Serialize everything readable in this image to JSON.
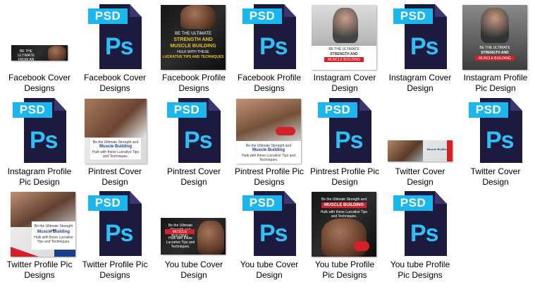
{
  "items": [
    {
      "label": "Facebook Cover Designs"
    },
    {
      "label": "Facebook Cover Designs"
    },
    {
      "label": "Facebook Profile Designs"
    },
    {
      "label": "Facebook Profile Designs"
    },
    {
      "label": "Instagram Cover Design"
    },
    {
      "label": "Instagram Cover Design"
    },
    {
      "label": "Instagram Profile Pic Design"
    },
    {
      "label": "Instagram Profile Pic Design"
    },
    {
      "label": "Pintrest Cover Design"
    },
    {
      "label": "Pintrest Cover Design"
    },
    {
      "label": "Pintrest Profile Pic Designs"
    },
    {
      "label": "Pintrest Profile Pic Design"
    },
    {
      "label": "Twitter Cover Design"
    },
    {
      "label": "Twitter Cover Design"
    },
    {
      "label": "Twitter Profile Pic Designs"
    },
    {
      "label": "Twitter Profile Pic Designs"
    },
    {
      "label": "You tube Cover Design"
    },
    {
      "label": "You tube Cover Design"
    },
    {
      "label": "You tube Profile Pic Designs"
    },
    {
      "label": "You tube Profile Pic Designs"
    }
  ],
  "psd_badge": "PSD",
  "ps_logo": "Ps",
  "thumb_text": {
    "fb_cover": "BE THE ULTIMATE FROM AN",
    "fb_profile_1": "BE THE ULTIMATE",
    "fb_profile_2": "STRENGTH AND",
    "fb_profile_3": "MUSCLE BUILDING",
    "fb_profile_4": "HULK WITH THESE",
    "fb_profile_5": "LUCRATIVE TIPS AND TECHNIQUES",
    "ig_1": "BE THE ULTIMATE",
    "ig_2": "STRENGTH AND",
    "ig_3": "MUSCLE BUILDING",
    "pin_1": "Be the Ultimate Strength and",
    "pin_2": "Muscle Building",
    "pin_3": "Hulk with these Lucrative Tips and Techniques.",
    "tw_1": "Be the Ultimate Strength and",
    "tw_2": "Muscle Building",
    "tw_3": "Hulk with these Lucrative Tips and Techniques.",
    "yt_1": "Be the Ultimate Strength and",
    "yt_2": "MUSCLE BUILDING",
    "yt_3": "Hulk with these Lucrative Tips and Techniques."
  }
}
